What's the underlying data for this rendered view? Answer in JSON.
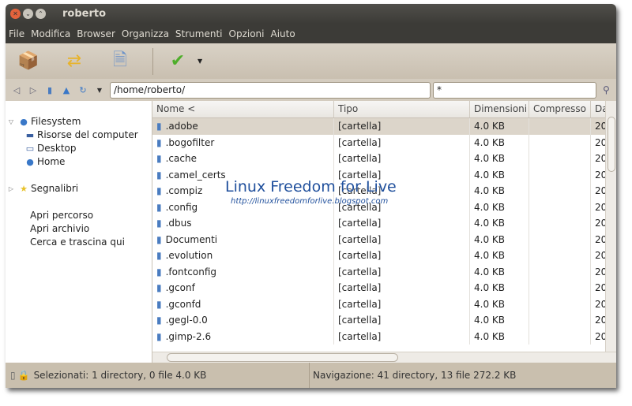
{
  "window": {
    "title": "roberto"
  },
  "menu": [
    "File",
    "Modifica",
    "Browser",
    "Organizza",
    "Strumenti",
    "Opzioni",
    "Aiuto"
  ],
  "toolbar": {
    "icons": [
      "extract-icon",
      "convert-icon",
      "open-icon",
      "test-icon"
    ]
  },
  "address": {
    "path": "/home/roberto/",
    "filter": "*"
  },
  "sidebar": {
    "filesystem": "Filesystem",
    "items": [
      "Risorse del computer",
      "Desktop",
      "Home"
    ],
    "bookmarks": "Segnalibri",
    "actions": [
      "Apri percorso",
      "Apri archivio",
      "Cerca e trascina qui"
    ]
  },
  "columns": [
    "Nome <",
    "Tipo",
    "Dimensioni",
    "Compresso",
    "Da"
  ],
  "rows": [
    {
      "name": ".adobe",
      "type": "[cartella]",
      "size": "4.0 KB",
      "date": "20"
    },
    {
      "name": ".bogofilter",
      "type": "[cartella]",
      "size": "4.0 KB",
      "date": "20"
    },
    {
      "name": ".cache",
      "type": "[cartella]",
      "size": "4.0 KB",
      "date": "20"
    },
    {
      "name": ".camel_certs",
      "type": "[cartella]",
      "size": "4.0 KB",
      "date": "20"
    },
    {
      "name": ".compiz",
      "type": "[cartella]",
      "size": "4.0 KB",
      "date": "20"
    },
    {
      "name": ".config",
      "type": "[cartella]",
      "size": "4.0 KB",
      "date": "20"
    },
    {
      "name": ".dbus",
      "type": "[cartella]",
      "size": "4.0 KB",
      "date": "20"
    },
    {
      "name": "Documenti",
      "type": "[cartella]",
      "size": "4.0 KB",
      "date": "20"
    },
    {
      "name": ".evolution",
      "type": "[cartella]",
      "size": "4.0 KB",
      "date": "20"
    },
    {
      "name": ".fontconfig",
      "type": "[cartella]",
      "size": "4.0 KB",
      "date": "20"
    },
    {
      "name": ".gconf",
      "type": "[cartella]",
      "size": "4.0 KB",
      "date": "20"
    },
    {
      "name": ".gconfd",
      "type": "[cartella]",
      "size": "4.0 KB",
      "date": "20"
    },
    {
      "name": ".gegl-0.0",
      "type": "[cartella]",
      "size": "4.0 KB",
      "date": "20"
    },
    {
      "name": ".gimp-2.6",
      "type": "[cartella]",
      "size": "4.0 KB",
      "date": "20"
    }
  ],
  "watermark": {
    "title": "Linux Freedom for Live",
    "url": "http://linuxfreedomforlive.blogspot.com"
  },
  "status": {
    "selected": "Selezionati: 1 directory, 0 file 4.0 KB",
    "navigation": "Navigazione: 41 directory, 13 file 272.2 KB"
  }
}
